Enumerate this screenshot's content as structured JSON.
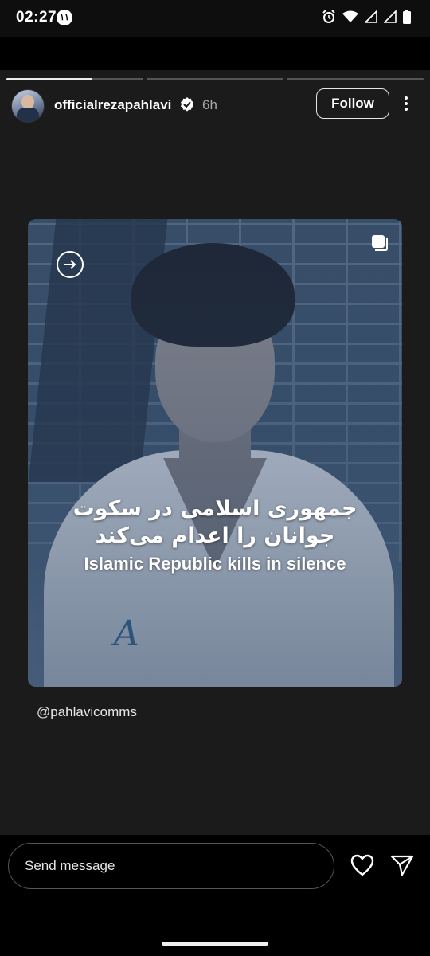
{
  "status_bar": {
    "time": "02:27",
    "notification_badge": "١١",
    "icons": [
      "alarm-icon",
      "wifi-icon",
      "signal-icon",
      "signal-icon",
      "battery-icon"
    ]
  },
  "story": {
    "progress_segments": [
      {
        "fill": 0.62
      },
      {
        "fill": 0.0
      },
      {
        "fill": 0.0
      }
    ],
    "username": "officialrezapahlavi",
    "verified_icon": "verified-badge-icon",
    "time_ago": "6h",
    "follow_label": "Follow",
    "post": {
      "text_persian_line1": "جمهوری اسلامی در سکوت",
      "text_persian_line2": "جوانان را اعدام می‌کند",
      "text_english": "Islamic Republic kills in silence",
      "gi_logo": "A"
    },
    "mention": "@pahlavicomms"
  },
  "bottom_bar": {
    "message_placeholder": "Send message",
    "icons": [
      "heart-icon",
      "send-icon"
    ]
  },
  "colors": {
    "story_bg": "#1b1b1b",
    "accent_white": "#ffffff",
    "muted_text": "#a8a8a8"
  }
}
